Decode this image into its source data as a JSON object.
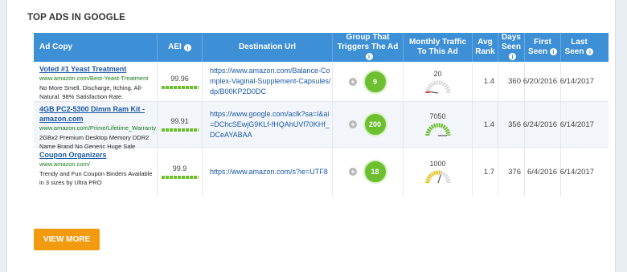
{
  "section_title": "TOP ADS IN GOOGLE",
  "columns": {
    "ad_copy": "Ad Copy",
    "aei": "AEI",
    "destination_url": "Destination Url",
    "group_line1": "Group That",
    "group_line2": "Triggers The Ad",
    "traffic_line1": "Monthly Traffic",
    "traffic_line2": "To This Ad",
    "rank_line1": "Avg",
    "rank_line2": "Rank",
    "days_line1": "Days",
    "days_line2": "Seen",
    "first_line1": "First",
    "first_line2": "Seen",
    "last_line1": "Last",
    "last_line2": "Seen"
  },
  "rows": [
    {
      "ad_title": "Voted #1 Yeast Treatment",
      "ad_url": "www.amazon.com/Best-Yeast-Treatment",
      "ad_desc": "No More Smell, Discharge, Itching. All-Natural. 98% Satisfaction Rate.",
      "aei": "99.96",
      "destination_url": "https://www.amazon.com/Balance-Complex-Vaginal-Supplement-Capsules/dp/B00KP2D0DC",
      "group": "9",
      "traffic": "20",
      "gauge_level": 0.05,
      "gauge_color": "#d9312b",
      "avg_rank": "1.4",
      "days_seen": "360",
      "first_seen": "6/20/2016",
      "last_seen": "6/14/2017"
    },
    {
      "ad_title": "4GB PC2-5300 Dimm Ram Kit - amazon.com",
      "ad_url": "www.amazon.com/Prime/Lifetime_Warranty",
      "ad_desc": "2GBx2 Premium Desktop Memory DDR2 Name Brand No Generic Huge Sale",
      "aei": "99.91",
      "destination_url": "https://www.google.com/aclk?sa=l&ai=DChcSEwjG9KLf-fHQAhUVf70KHf_DCeAYABAA",
      "group": "200",
      "traffic": "7050",
      "gauge_level": 1.0,
      "gauge_color": "#6cbf2e",
      "avg_rank": "1.4",
      "days_seen": "356",
      "first_seen": "6/24/2016",
      "last_seen": "6/14/2017"
    },
    {
      "ad_title": "Coupon Organizers",
      "ad_url": "www.amazon.com/",
      "ad_desc": "Trendy and Fun Coupon Binders Available in 3 sizes by Ultra PRO",
      "aei": "99.9",
      "destination_url": "https://www.amazon.com/s?ie=UTF8",
      "group": "18",
      "traffic": "1000",
      "gauge_level": 0.6,
      "gauge_color": "#e8c21a",
      "avg_rank": "1.7",
      "days_seen": "376",
      "first_seen": "6/4/2016",
      "last_seen": "6/14/2017"
    }
  ],
  "view_more_label": "VIEW MORE",
  "colors": {
    "header": "#3d8fd6",
    "button": "#f29b11",
    "badge": "#6cbf2e",
    "link": "#1b58a8"
  },
  "icons": {
    "info": "info-icon",
    "plus": "plus-icon"
  }
}
